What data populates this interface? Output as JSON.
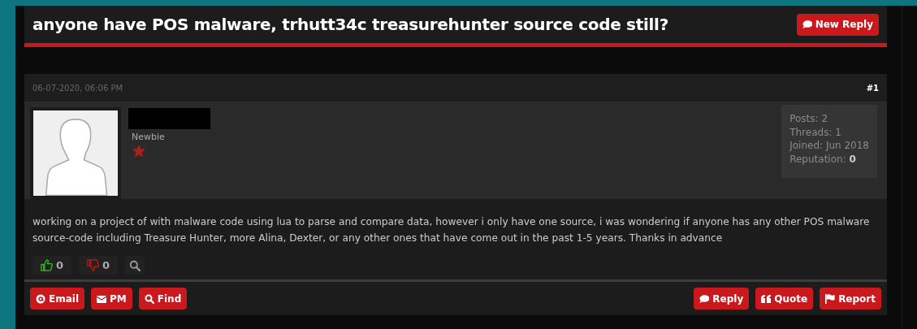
{
  "thread": {
    "title": "anyone have POS malware, trhutt34c treasurehunter source code still?",
    "new_reply": "New Reply"
  },
  "post": {
    "date": "06-07-2020, 06:06 PM",
    "number": "#1",
    "author": {
      "rank": "Newbie"
    },
    "stats": [
      {
        "label": "Posts:",
        "value": "2",
        "bold": false
      },
      {
        "label": "Threads:",
        "value": "1",
        "bold": false
      },
      {
        "label": "Joined:",
        "value": "Jun 2018",
        "bold": false
      },
      {
        "label": "Reputation:",
        "value": "0",
        "bold": true
      }
    ],
    "body": "working on a project of with malware code using lua to parse and compare data, however i only have one source, i was wondering if anyone has any other POS malware source-code including Treasure Hunter, more Alina, Dexter, or any other ones that have come out in the past 1-5 years. Thanks in advance",
    "votes": [
      {
        "kind": "up",
        "count": "0"
      },
      {
        "kind": "down",
        "count": "0"
      }
    ],
    "left_buttons": [
      {
        "kind": "email",
        "label": "Email"
      },
      {
        "kind": "pm",
        "label": "PM"
      },
      {
        "kind": "find",
        "label": "Find"
      }
    ],
    "right_buttons": [
      {
        "kind": "reply",
        "label": "Reply"
      },
      {
        "kind": "quote",
        "label": "Quote"
      },
      {
        "kind": "report",
        "label": "Report"
      }
    ]
  }
}
